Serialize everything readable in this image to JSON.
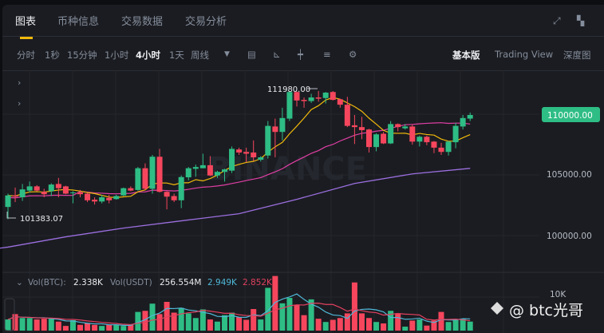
{
  "tabs": [
    {
      "label": "图表",
      "active": true
    },
    {
      "label": "币种信息"
    },
    {
      "label": "交易数据"
    },
    {
      "label": "交易分析"
    }
  ],
  "intervals": [
    {
      "label": "分时"
    },
    {
      "label": "1秒"
    },
    {
      "label": "15分钟"
    },
    {
      "label": "1小时"
    },
    {
      "label": "4小时",
      "active": true
    },
    {
      "label": "1天"
    },
    {
      "label": "周线"
    }
  ],
  "views": {
    "basic": "基本版",
    "tradingview": "Trading View",
    "depth": "深度图"
  },
  "price_axis": [
    "110000.00",
    "105000.00",
    "100000.00"
  ],
  "last_price": "110000.00",
  "high_label": "111980.00",
  "low_label": "101383.07",
  "volume": {
    "vol_btc_label": "Vol(BTC):",
    "vol_btc": "2.338K",
    "vol_usdt_label": "Vol(USDT)",
    "vol_usdt": "256.554M",
    "ma5": "2.949K",
    "ma10": "2.852K",
    "axis_label": "10K"
  },
  "watermark": "@ btc光哥",
  "logo_watermark": "BINANCE",
  "colors": {
    "up": "#2ebd85",
    "down": "#f6465d",
    "ma7": "#f0b90b",
    "ma25": "#e03fa5",
    "ma99": "#9b6fe0",
    "vma5": "#4fb8d8",
    "vma10": "#e0405f",
    "accent": "#f0b90b"
  },
  "chart_data": {
    "type": "candlestick",
    "interval": "4h",
    "ylim": [
      97500,
      113000
    ],
    "ohlc": [
      [
        102400,
        103350,
        101383,
        103500
      ],
      [
        103350,
        103250,
        102800,
        104000
      ],
      [
        103200,
        103850,
        102900,
        104300
      ],
      [
        103750,
        104100,
        103600,
        104500
      ],
      [
        104100,
        103750,
        103700,
        104200
      ],
      [
        103650,
        103450,
        103200,
        103900
      ],
      [
        103700,
        104250,
        103300,
        104350
      ],
      [
        104300,
        103950,
        103200,
        104800
      ],
      [
        104100,
        103500,
        103450,
        104150
      ],
      [
        103550,
        103600,
        102700,
        103700
      ],
      [
        103600,
        103450,
        103200,
        103800
      ],
      [
        103500,
        102950,
        102800,
        103550
      ],
      [
        103000,
        102850,
        102600,
        103200
      ],
      [
        102850,
        103200,
        102700,
        103400
      ],
      [
        103150,
        102950,
        102700,
        103400
      ],
      [
        103050,
        103300,
        103000,
        103400
      ],
      [
        103350,
        103950,
        103300,
        104000
      ],
      [
        103950,
        103750,
        103700,
        104100
      ],
      [
        103800,
        105600,
        103750,
        105700
      ],
      [
        105600,
        103900,
        103800,
        106000
      ],
      [
        103900,
        106550,
        103500,
        106700
      ],
      [
        106550,
        103650,
        103600,
        107200
      ],
      [
        103650,
        103250,
        102200,
        103700
      ],
      [
        103300,
        102950,
        102800,
        103500
      ],
      [
        102950,
        104870,
        102300,
        105000
      ],
      [
        104850,
        105600,
        104600,
        105700
      ],
      [
        105550,
        105700,
        104900,
        105900
      ],
      [
        105600,
        105850,
        105600,
        106800
      ],
      [
        105850,
        105000,
        104950,
        106600
      ],
      [
        105000,
        105300,
        104800,
        105400
      ],
      [
        105300,
        105500,
        104500,
        105550
      ],
      [
        105400,
        107200,
        105200,
        107400
      ],
      [
        107150,
        106900,
        106700,
        107300
      ],
      [
        106950,
        106800,
        106100,
        107300
      ],
      [
        106900,
        106500,
        106200,
        107900
      ],
      [
        106300,
        106500,
        106150,
        106600
      ],
      [
        106650,
        109100,
        106400,
        109500
      ],
      [
        109050,
        108600,
        106500,
        109700
      ],
      [
        108600,
        109750,
        107900,
        110600
      ],
      [
        109700,
        111900,
        109500,
        111980
      ],
      [
        111900,
        111200,
        110700,
        111950
      ],
      [
        111250,
        111150,
        110600,
        111450
      ],
      [
        111150,
        111450,
        111000,
        111750
      ],
      [
        111450,
        111350,
        111100,
        111980
      ],
      [
        111400,
        111850,
        110950,
        111900
      ],
      [
        111900,
        111250,
        111200,
        111980
      ],
      [
        111300,
        110850,
        110600,
        111350
      ],
      [
        110850,
        109100,
        109000,
        111500
      ],
      [
        109150,
        109000,
        107600,
        110000
      ],
      [
        109000,
        108750,
        108000,
        109850
      ],
      [
        108800,
        107350,
        106900,
        108850
      ],
      [
        107350,
        108400,
        107000,
        108500
      ],
      [
        108450,
        107650,
        107600,
        108600
      ],
      [
        107650,
        109250,
        107600,
        109500
      ],
      [
        109250,
        109000,
        108650,
        109300
      ],
      [
        108900,
        109050,
        108800,
        109250
      ],
      [
        109050,
        107800,
        107550,
        109200
      ],
      [
        107800,
        108200,
        107400,
        108300
      ],
      [
        108200,
        107750,
        107500,
        108300
      ],
      [
        107800,
        107300,
        106850,
        107850
      ],
      [
        107300,
        106950,
        106700,
        107700
      ],
      [
        106950,
        107800,
        106650,
        107850
      ],
      [
        107750,
        109100,
        107250,
        109350
      ],
      [
        109050,
        109750,
        108800,
        110000
      ],
      [
        109700,
        110000,
        109500,
        110200
      ]
    ],
    "ma99_samples": [
      99080,
      99930,
      100650,
      101250,
      101840,
      103030,
      104340,
      105130,
      105590
    ],
    "volume_k": [
      3.1,
      4.6,
      3.5,
      3.5,
      3.1,
      3.3,
      3.3,
      2.5,
      1.3,
      2.9,
      1.6,
      2.0,
      1.6,
      1.3,
      1.6,
      1.6,
      1.3,
      1.6,
      5.2,
      5.5,
      7.5,
      4.6,
      8.0,
      5.0,
      6.3,
      4.8,
      3.5,
      5.9,
      3.1,
      2.5,
      4.3,
      5.0,
      3.7,
      3.0,
      6.0,
      3.1,
      11.9,
      15.2,
      7.6,
      9.1,
      7.2,
      4.3,
      8.7,
      3.3,
      2.4,
      3.0,
      3.5,
      4.8,
      13.4,
      4.8,
      3.5,
      2.4,
      2.0,
      5.5,
      4.8,
      1.1,
      2.8,
      3.1,
      1.4,
      2.8,
      5.2,
      2.4,
      2.9,
      3.3,
      2.5
    ]
  }
}
